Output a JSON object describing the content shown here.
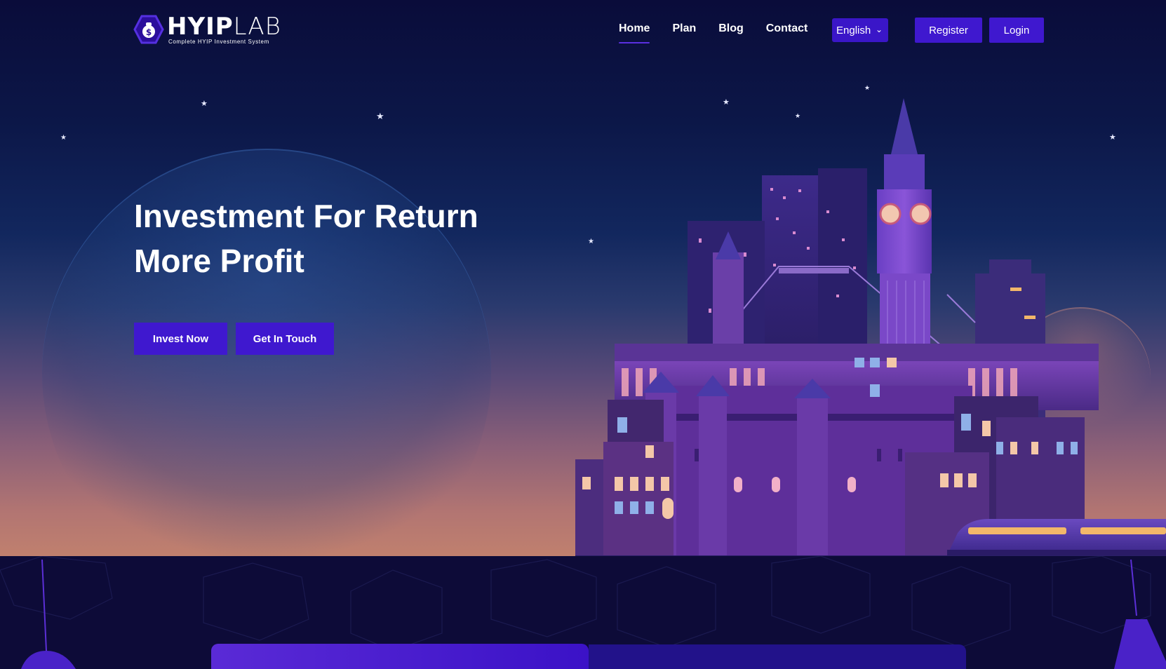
{
  "brand": {
    "name_bold": "HYIP",
    "name_light": "LAB",
    "tagline": "Complete HYIP Investment System",
    "logo_icon": "money-bag-icon"
  },
  "nav": {
    "items": [
      {
        "label": "Home",
        "active": true
      },
      {
        "label": "Plan",
        "active": false
      },
      {
        "label": "Blog",
        "active": false
      },
      {
        "label": "Contact",
        "active": false
      }
    ]
  },
  "language": {
    "selected": "English",
    "icon": "chevron-down-icon"
  },
  "auth": {
    "register_label": "Register",
    "login_label": "Login"
  },
  "hero": {
    "title_line1": "Investment For Return",
    "title_line2": "More Profit",
    "primary_cta": "Invest Now",
    "secondary_cta": "Get In Touch"
  },
  "colors": {
    "accent": "#3f18cf",
    "nav_underline": "#5a2fe0",
    "background_dark": "#0b0a35",
    "sky_bottom": "#c0806e"
  }
}
